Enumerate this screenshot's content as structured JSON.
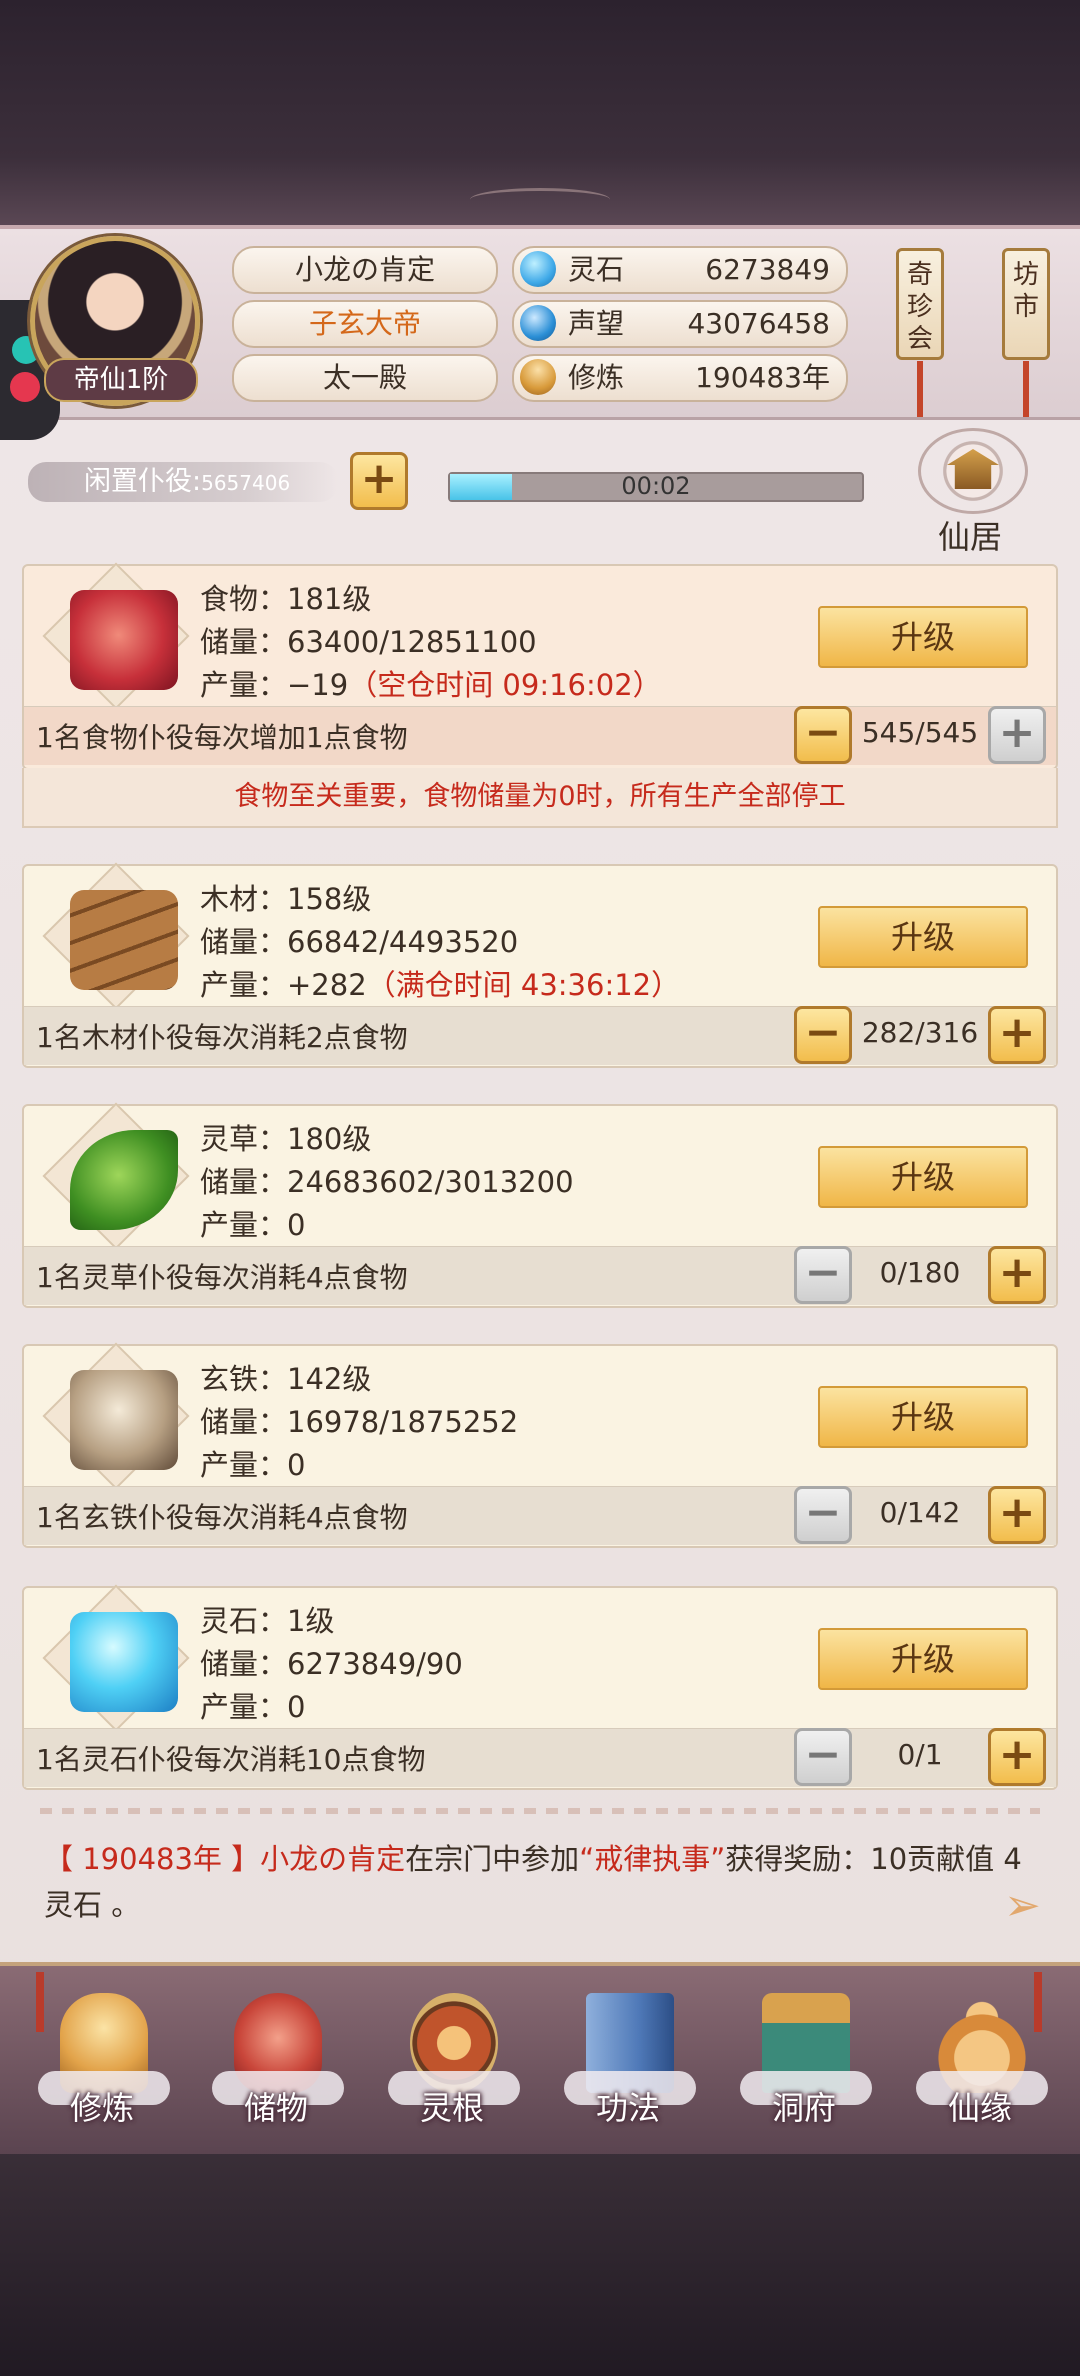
{
  "player": {
    "rank_badge": "帝仙1阶",
    "names": [
      "小龙の肯定",
      "子玄大帝",
      "太一殿"
    ],
    "stats": [
      {
        "label": "灵石",
        "value": "6273849",
        "icon": "spirit-stone-icon",
        "color": "#3fa9e8"
      },
      {
        "label": "声望",
        "value": "43076458",
        "icon": "prestige-icon",
        "color": "#2b8fd6"
      },
      {
        "label": "修炼",
        "value": "190483年",
        "icon": "meditation-icon",
        "color": "#d89a3a"
      }
    ]
  },
  "side_menu": [
    {
      "label": "奇珍会"
    },
    {
      "label": "坊市"
    }
  ],
  "idle": {
    "label": "闲置仆役",
    "sep": ":",
    "count": "5657406",
    "timer": "00:02",
    "progress": 0.15
  },
  "residence": {
    "label": "仙居"
  },
  "resources": [
    {
      "id": "food",
      "icon": "meat-icon",
      "name_line": "食物：181级",
      "storage_line": "储量：63400/12851100",
      "prod_line": "产量：−19",
      "prod_extra": "（空仓时间 09:16:02）",
      "upgrade": "升级",
      "worker_line": "1名食物仆役每次增加1点食物",
      "count": "545/545",
      "minus_active": true,
      "plus_active": false
    },
    {
      "id": "wood",
      "icon": "wood-logs-icon",
      "name_line": "木材：158级",
      "storage_line": "储量：66842/4493520",
      "prod_line": "产量：+282",
      "prod_extra": "（满仓时间 43:36:12）",
      "upgrade": "升级",
      "worker_line": "1名木材仆役每次消耗2点食物",
      "count": "282/316",
      "minus_active": true,
      "plus_active": true
    },
    {
      "id": "herb",
      "icon": "herb-leaf-icon",
      "name_line": "灵草：180级",
      "storage_line": "储量：24683602/3013200",
      "prod_line": "产量：0",
      "prod_extra": "",
      "upgrade": "升级",
      "worker_line": "1名灵草仆役每次消耗4点食物",
      "count": "0/180",
      "minus_active": false,
      "plus_active": true
    },
    {
      "id": "iron",
      "icon": "iron-ore-icon",
      "name_line": "玄铁：142级",
      "storage_line": "储量：16978/1875252",
      "prod_line": "产量：0",
      "prod_extra": "",
      "upgrade": "升级",
      "worker_line": "1名玄铁仆役每次消耗4点食物",
      "count": "0/142",
      "minus_active": false,
      "plus_active": true
    },
    {
      "id": "stone",
      "icon": "blue-crystal-icon",
      "name_line": "灵石：1级",
      "storage_line": "储量：6273849/90",
      "prod_line": "产量：0",
      "prod_extra": "",
      "upgrade": "升级",
      "worker_line": "1名灵石仆役每次消耗10点食物",
      "count": "0/1",
      "minus_active": false,
      "plus_active": true
    }
  ],
  "warning": "食物至关重要，食物储量为0时，所有生产全部停工",
  "log": {
    "year": "【 190483年 】",
    "player": "小龙の肯定",
    "text1": "在宗门中参加",
    "event": "“戒律执事”",
    "text2": "获得奖励：10贡献值 4灵石 。"
  },
  "nav": [
    {
      "label": "修炼",
      "icon": "cultivation-icon",
      "color": "#e2a34a"
    },
    {
      "label": "储物",
      "icon": "storage-bag-icon",
      "color": "#c9463a"
    },
    {
      "label": "灵根",
      "icon": "spirit-root-icon",
      "color": "#c0542c"
    },
    {
      "label": "功法",
      "icon": "scripture-book-icon",
      "color": "#4f79b8"
    },
    {
      "label": "洞府",
      "icon": "cave-mansion-icon",
      "color": "#3b8a7a"
    },
    {
      "label": "仙缘",
      "icon": "gourd-icon",
      "color": "#d88a3a"
    }
  ]
}
